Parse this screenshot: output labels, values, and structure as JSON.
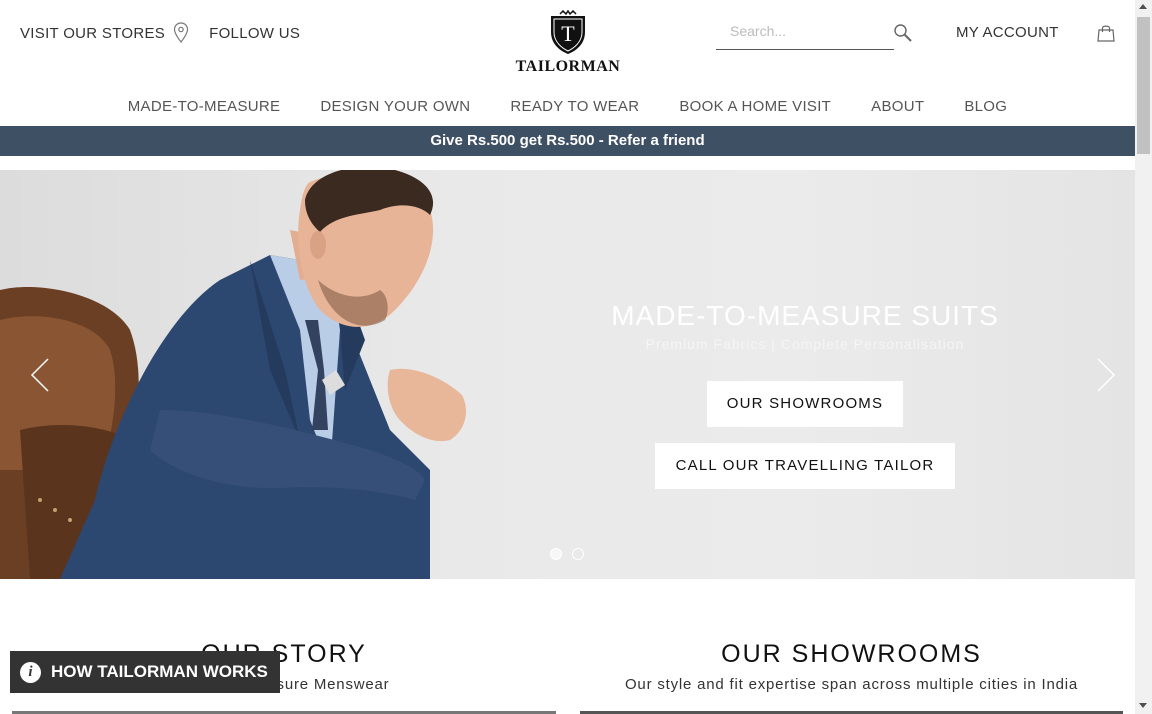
{
  "header": {
    "visit_stores": "VISIT OUR STORES",
    "follow_us": "FOLLOW US",
    "logo_text": "TAILORMAN",
    "logo_letter": "T",
    "search_placeholder": "Search...",
    "my_account": "MY ACCOUNT"
  },
  "nav": {
    "items": [
      "MADE-TO-MEASURE",
      "DESIGN YOUR OWN",
      "READY TO WEAR",
      "BOOK A HOME VISIT",
      "ABOUT",
      "BLOG"
    ]
  },
  "promo": {
    "text": "Give Rs.500 get Rs.500 - Refer a friend",
    "bg_color": "#3e5064"
  },
  "hero": {
    "title": "MADE-TO-MEASURE SUITS",
    "subtitle": "Premium Fabrics | Complete Personalisation",
    "buttons": [
      "OUR SHOWROOMS",
      "CALL OUR TRAVELLING TAILOR"
    ],
    "slide_count": 2,
    "active_slide": 1
  },
  "sections": {
    "story": {
      "title": "OUR STORY",
      "subtitle": "Made-to-Measure Menswear"
    },
    "showrooms": {
      "title": "OUR SHOWROOMS",
      "subtitle": "Our style and fit expertise span across multiple cities in India"
    }
  },
  "floating": {
    "how_it_works": "HOW TAILORMAN WORKS",
    "info_glyph": "i"
  },
  "icons": {
    "location": "map-pin-icon",
    "search": "search-icon",
    "cart": "shopping-bag-icon",
    "info": "info-icon"
  }
}
